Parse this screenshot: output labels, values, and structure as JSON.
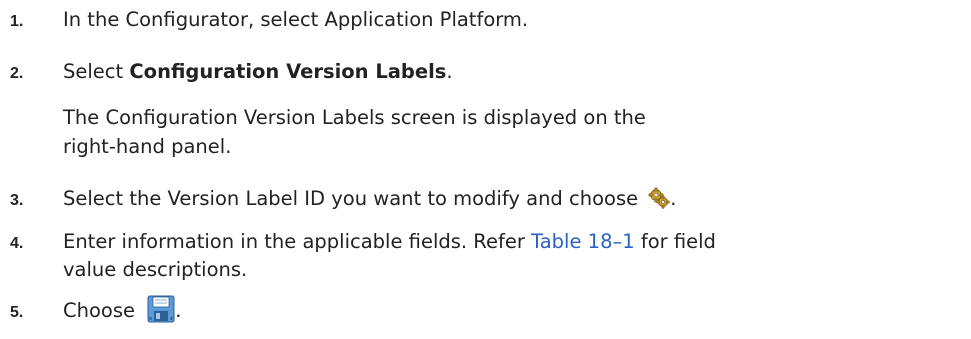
{
  "steps": [
    {
      "number": "1.",
      "text": "In the Configurator, select Application Platform."
    },
    {
      "number": "2.",
      "text_before": "Select ",
      "text_bold": "Configuration Version Labels",
      "text_after": "."
    },
    {
      "result_line1": "The Configuration Version Labels screen is displayed on the",
      "result_line2": "right-hand panel."
    },
    {
      "number": "3.",
      "text_before": "Select the Version Label ID you want to modify and choose ",
      "icon": "gear-icon",
      "text_after": "."
    },
    {
      "number": "4.",
      "line1_before": "Enter information in the applicable fields. Refer ",
      "link": "Table 18–1",
      "line1_after": " for field",
      "line2": "value descriptions."
    },
    {
      "number": "5.",
      "text_before": "Choose ",
      "icon": "save-icon",
      "text_after": "."
    }
  ],
  "colors": {
    "text": "#222222",
    "link": "#2a62c4"
  }
}
